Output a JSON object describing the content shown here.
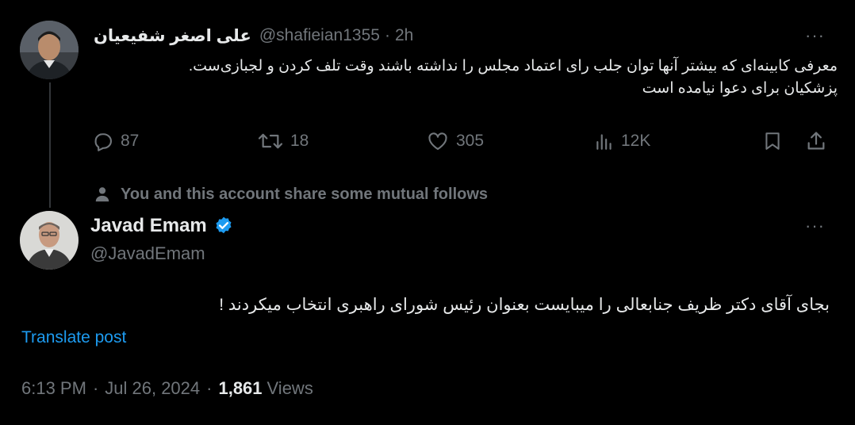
{
  "reply_context": {
    "display_name": "علی اصغر شفیعیان",
    "handle": "@shafieian1355",
    "separator": "·",
    "time": "2h",
    "text_line1": "معرفی کابینه‌ای که بیشتر آنها توان جلب رای اعتماد مجلس را نداشته باشند وقت تلف کردن و لجبازی‌ست.",
    "text_line2": "پزشکیان برای دعوا نیامده است",
    "replies": "87",
    "reposts": "18",
    "likes": "305",
    "views": "12K"
  },
  "mutual_follows": {
    "text": "You and this account share some mutual follows"
  },
  "main_tweet": {
    "display_name": "Javad Emam",
    "handle": "@JavadEmam",
    "text": "بجای آقای دکتر ظریف جنابعالی را میبایست بعنوان رئیس شورای راهبری انتخاب میکردند !",
    "translate_label": "Translate post",
    "time": "6:13 PM",
    "dot1": "·",
    "date": "Jul 26, 2024",
    "dot2": "·",
    "views_count": "1,861",
    "views_label": "Views"
  },
  "more_menu": "···",
  "colors": {
    "background": "#000000",
    "text": "#e7e9ea",
    "muted": "#71767b",
    "link": "#1d9bf0",
    "verified": "#1d9bf0",
    "thread_line": "#333639"
  },
  "icons": {
    "reply": "reply-icon",
    "repost": "repost-icon",
    "like": "heart-icon",
    "views": "views-icon",
    "bookmark": "bookmark-icon",
    "share": "share-icon",
    "person": "person-icon",
    "verified": "verified-badge-icon"
  }
}
